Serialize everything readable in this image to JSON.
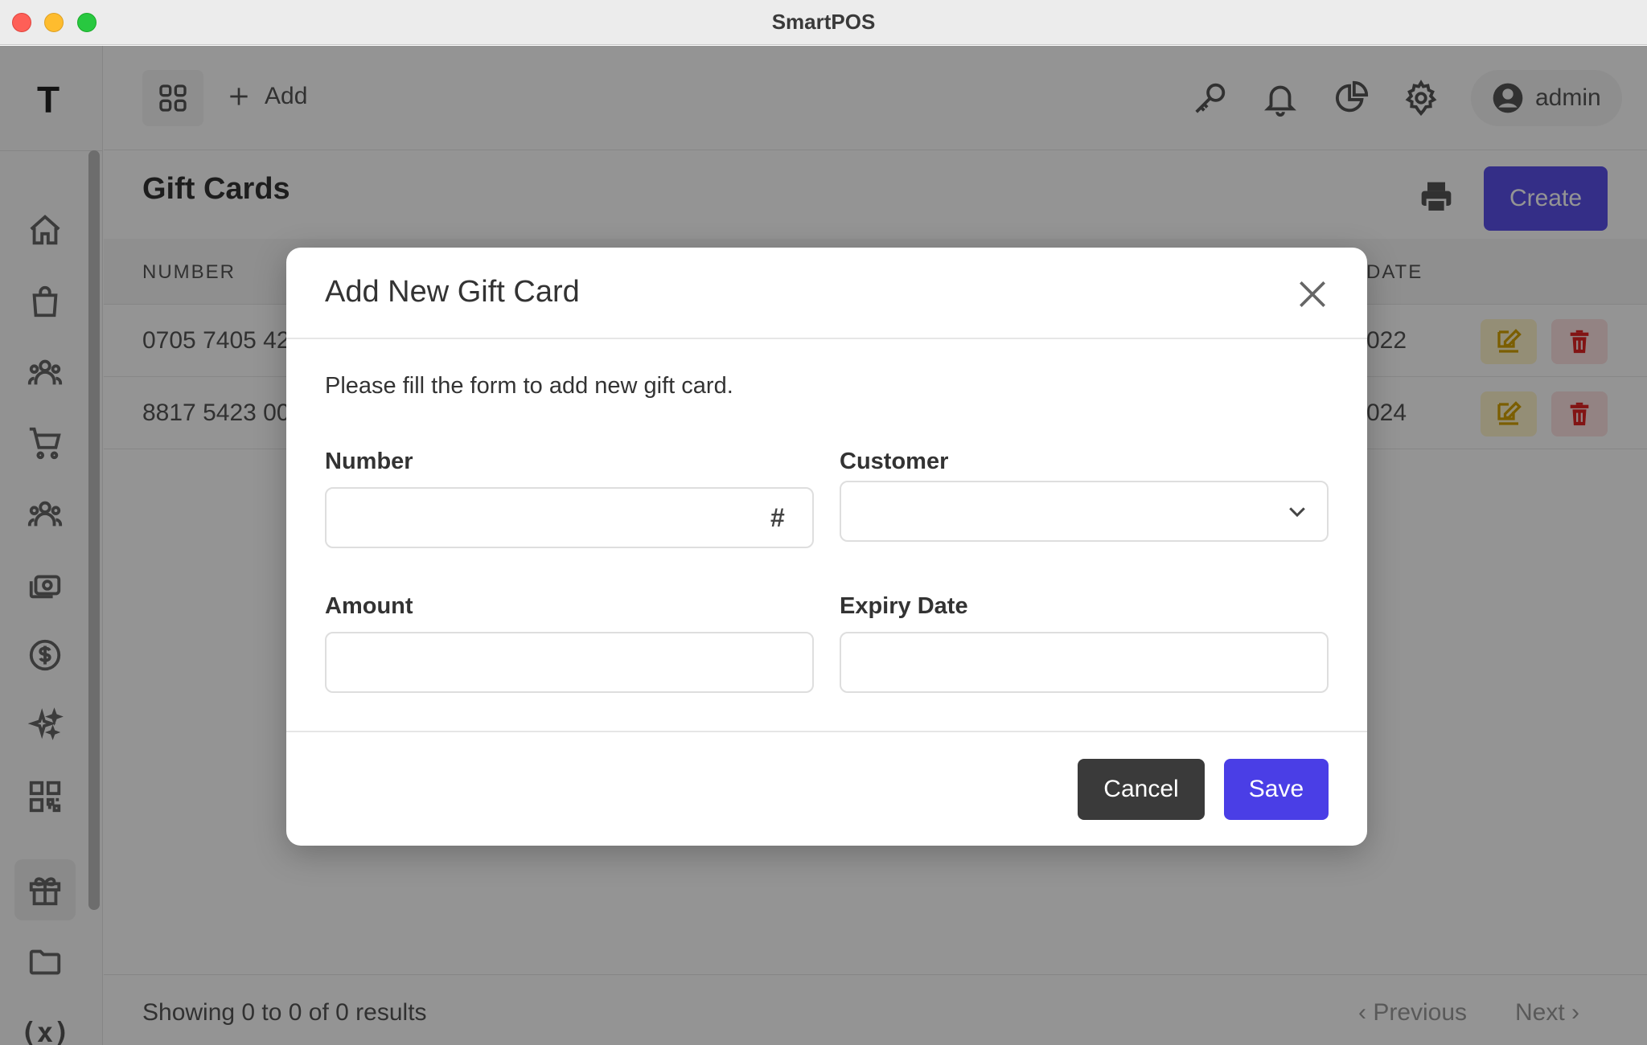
{
  "window": {
    "title": "SmartPOS"
  },
  "sidebar": {
    "logo": "T",
    "items": [
      {
        "icon": "home-icon"
      },
      {
        "icon": "shopping-bag-icon"
      },
      {
        "icon": "users-icon"
      },
      {
        "icon": "cart-icon"
      },
      {
        "icon": "user-group-icon"
      },
      {
        "icon": "cash-icon"
      },
      {
        "icon": "dollar-circle-icon"
      },
      {
        "icon": "sparkles-icon"
      },
      {
        "icon": "qr-code-icon"
      },
      {
        "icon": "gift-icon",
        "active": true
      },
      {
        "icon": "folder-icon"
      },
      {
        "icon": "variable-icon",
        "text": "(x)"
      }
    ]
  },
  "topbar": {
    "add_label": "Add",
    "user_label": "admin"
  },
  "page": {
    "title": "Gift Cards",
    "create_label": "Create"
  },
  "table": {
    "columns": [
      "NUMBER",
      "DATE"
    ],
    "rows": [
      {
        "number": "0705 7405 42",
        "date": "022"
      },
      {
        "number": "8817 5423 00",
        "date": "024"
      }
    ]
  },
  "footer": {
    "results": "Showing 0 to 0 of 0 results",
    "previous": "Previous",
    "next": "Next"
  },
  "modal": {
    "title": "Add New Gift Card",
    "description": "Please fill the form to add new gift card.",
    "fields": {
      "number_label": "Number",
      "number_value": "",
      "number_suffix": "#",
      "customer_label": "Customer",
      "customer_value": "",
      "amount_label": "Amount",
      "amount_value": "",
      "expiry_label": "Expiry Date",
      "expiry_value": ""
    },
    "cancel_label": "Cancel",
    "save_label": "Save"
  },
  "colors": {
    "primary": "#4a3ee6",
    "create_button": "#5b50e8",
    "cancel_button": "#3a3a3a",
    "edit_bg": "#fff4cc",
    "edit_icon": "#d4a300",
    "delete_bg": "#fde2e2",
    "delete_icon": "#e02424"
  }
}
